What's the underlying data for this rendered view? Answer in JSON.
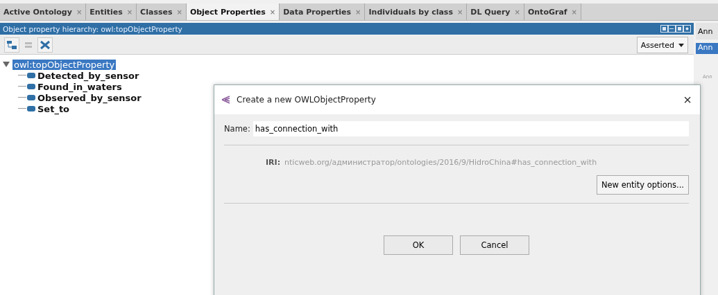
{
  "tabs": [
    {
      "label": "Active Ontology",
      "close": "×",
      "selected": false
    },
    {
      "label": "Entities",
      "close": "×",
      "selected": false
    },
    {
      "label": "Classes",
      "close": "×",
      "selected": false
    },
    {
      "label": "Object Properties",
      "close": "×",
      "selected": true
    },
    {
      "label": "Data Properties",
      "close": "×",
      "selected": false
    },
    {
      "label": "Individuals by class",
      "close": "×",
      "selected": false
    },
    {
      "label": "DL Query",
      "close": "×",
      "selected": false
    },
    {
      "label": "OntoGraf",
      "close": "×",
      "selected": false
    }
  ],
  "hierarchy": {
    "title": "Object property hierarchy: owl:topObjectProperty",
    "mode": "Asserted",
    "tree": [
      {
        "label": "owl:topObjectProperty",
        "selected": true,
        "expanded": true,
        "children": [
          {
            "label": "Detected_by_sensor",
            "selected": false
          },
          {
            "label": "Found_in_waters",
            "selected": false
          },
          {
            "label": "Observed_by_sensor",
            "selected": false
          },
          {
            "label": "Set_to",
            "selected": false
          }
        ]
      }
    ]
  },
  "side_panel": {
    "header": "Ann",
    "tab": "Ann",
    "note": "Ann"
  },
  "dialog": {
    "title": "Create a new OWLObjectProperty",
    "close": "×",
    "name_label": "Name:",
    "name_value": "has_connection_with",
    "iri_label": "IRI:",
    "iri_value": "nticweb.org/администратор/ontologies/2016/9/HidroChina#has_connection_with",
    "options_button": "New entity options...",
    "buttons": [
      "OK",
      "Cancel"
    ]
  }
}
